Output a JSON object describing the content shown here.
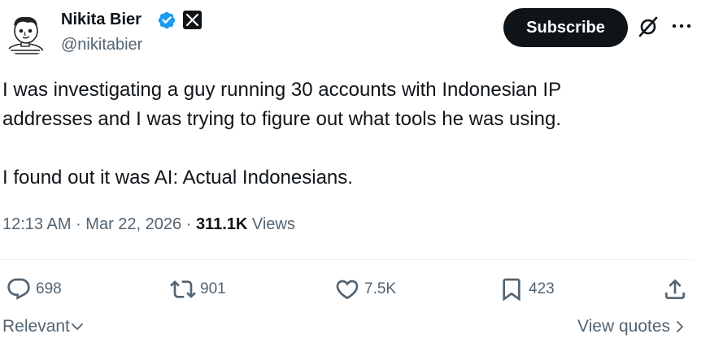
{
  "author": {
    "name": "Nikita Bier",
    "handle": "@nikitabier"
  },
  "header": {
    "subscribe_label": "Subscribe"
  },
  "tweet": {
    "line1": "I was investigating a guy running 30 accounts with Indonesian IP",
    "line2": "addresses and I was trying to figure out what tools he was using.",
    "line3": "I found out it was AI: Actual Indonesians.",
    "time": "12:13 AM",
    "sep1": " · ",
    "date": "Mar 22, 2026",
    "sep2": " · ",
    "views_count": "311.1K",
    "views_label": " Views"
  },
  "actions": {
    "replies": "698",
    "reposts": "901",
    "likes": "7.5K",
    "bookmarks": "423"
  },
  "footer": {
    "sort_label": "Relevant",
    "view_quotes_label": "View quotes"
  },
  "icons": [
    "verified-badge-icon",
    "x-logo-icon",
    "grok-icon",
    "more-icon",
    "reply-icon",
    "repost-icon",
    "like-icon",
    "bookmark-icon",
    "share-icon",
    "chevron-down-icon",
    "chevron-right-icon"
  ],
  "colors": {
    "text": "#0f1419",
    "secondary": "#536471",
    "verified": "#1d9bf0",
    "button": "#0f1419",
    "divider": "#eff3f4"
  }
}
